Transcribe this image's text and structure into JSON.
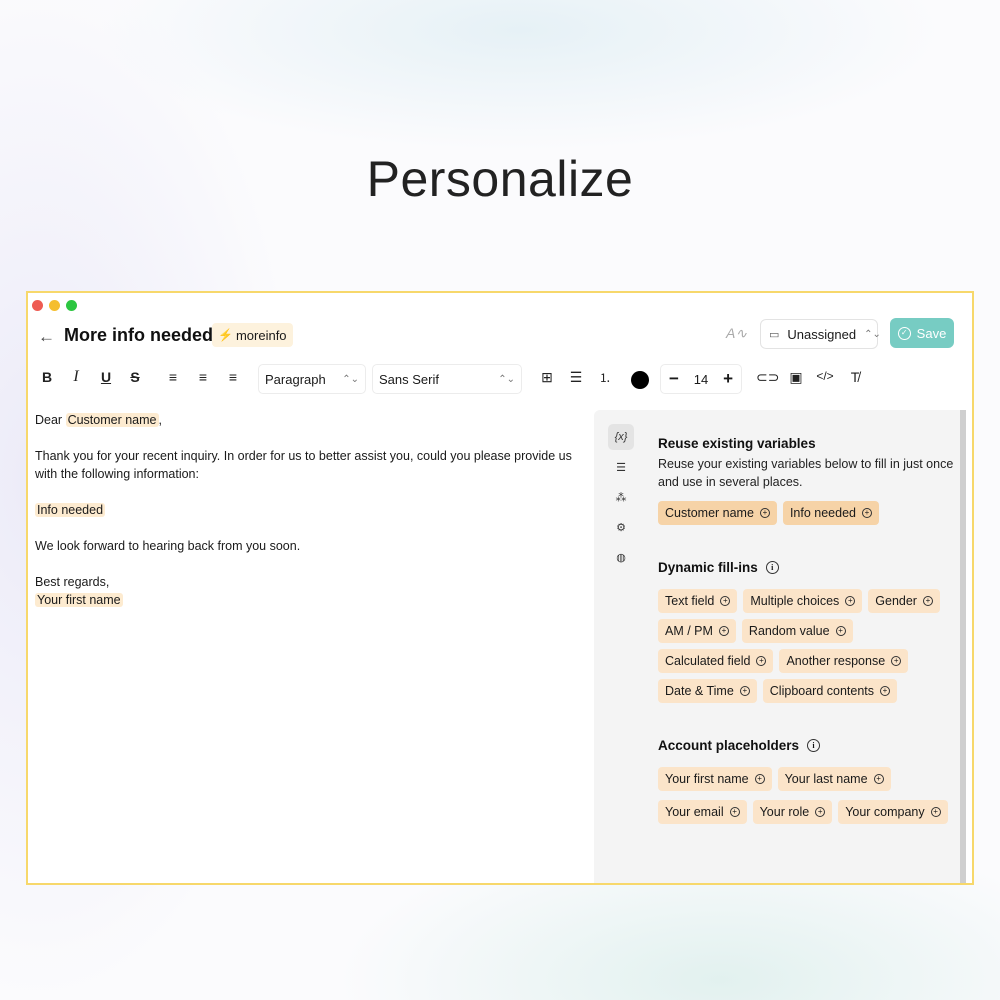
{
  "hero": {
    "title": "Personalize"
  },
  "window": {
    "colors": {
      "accent_border": "#f7d86b",
      "save": "#77ccc3",
      "chip": "#fbe4c9",
      "variable_highlight": "#fdebd0"
    }
  },
  "header": {
    "back_icon": "arrow-left-icon",
    "title": "More info needed",
    "shortcut": "moreinfo",
    "assignee": "Unassigned",
    "save_label": "Save"
  },
  "toolbar": {
    "bold": "B",
    "italic": "I",
    "underline": "U",
    "strike": "S",
    "block_style": "Paragraph",
    "font": "Sans Serif",
    "font_size": "14",
    "decrease": "−",
    "increase": "+"
  },
  "editor": {
    "greeting_prefix": "Dear ",
    "greeting_var": "Customer name",
    "greeting_suffix": ",",
    "paragraph1": "Thank you for your recent inquiry. In order for us to better assist you, could you please provide us with the following information:",
    "info_var": "Info needed",
    "paragraph2": "We look forward to hearing back from you soon.",
    "signoff": "Best regards,",
    "signature_var": "Your first name"
  },
  "panel": {
    "reuse": {
      "title": "Reuse existing variables",
      "description": "Reuse your existing variables below to fill in just once and use in several places.",
      "chips": [
        "Customer name",
        "Info needed"
      ]
    },
    "dynamic": {
      "title": "Dynamic fill-ins",
      "chips": [
        "Text field",
        "Multiple choices",
        "Gender",
        "AM / PM",
        "Random value",
        "Calculated field",
        "Another response",
        "Date & Time",
        "Clipboard contents"
      ]
    },
    "account": {
      "title": "Account placeholders",
      "chips": [
        "Your first name",
        "Your last name",
        "Your email",
        "Your role",
        "Your company"
      ]
    }
  }
}
